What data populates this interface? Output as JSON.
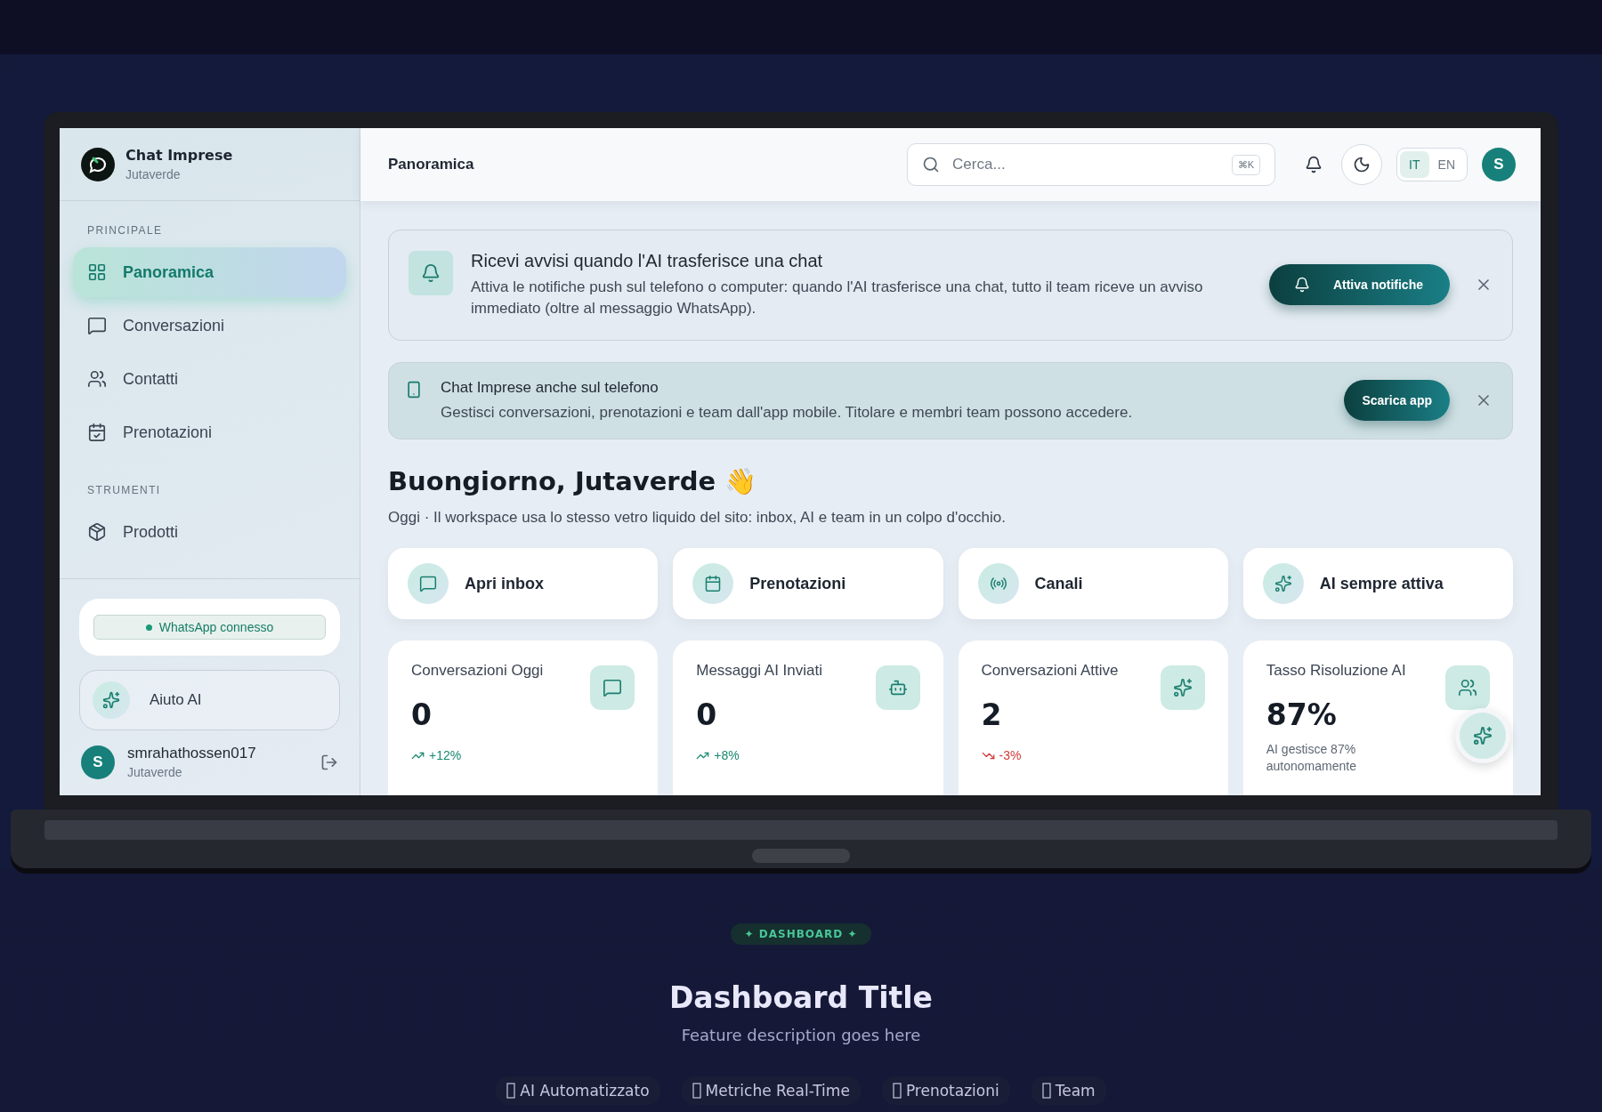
{
  "sidebar": {
    "brand": {
      "name": "Chat Imprese",
      "subtitle": "Jutaverde"
    },
    "sections": [
      {
        "title": "PRINCIPALE",
        "items": [
          {
            "label": "Panoramica",
            "selected": true
          },
          {
            "label": "Conversazioni",
            "selected": false
          },
          {
            "label": "Contatti",
            "selected": false
          },
          {
            "label": "Prenotazioni",
            "selected": false
          }
        ]
      },
      {
        "title": "STRUMENTI",
        "items": [
          {
            "label": "Prodotti",
            "selected": false
          }
        ]
      }
    ],
    "whatsapp_status": {
      "label": "WhatsApp connesso",
      "connected": true
    },
    "help": {
      "label": "Aiuto AI"
    },
    "user": {
      "initial": "S",
      "name": "smrahathossen017",
      "workspace": "Jutaverde"
    }
  },
  "topbar": {
    "title": "Panoramica",
    "search": {
      "placeholder": "Cerca...",
      "shortcut": "⌘K"
    },
    "languages": [
      {
        "label": "IT",
        "selected": true
      },
      {
        "label": "EN",
        "selected": false
      }
    ],
    "avatar": "S"
  },
  "banners": [
    {
      "kind": "alert",
      "title": "Ricevi avvisi quando l'AI trasferisce una chat",
      "text": "Attiva le notifiche push sul telefono o computer: quando l'AI trasferisce una chat, tutto il team riceve un avviso immediato (oltre al messaggio WhatsApp).",
      "button": "Attiva notifiche"
    },
    {
      "kind": "app",
      "title": "Chat Imprese anche sul telefono",
      "text": "Gestisci conversazioni, prenotazioni e team dall'app mobile. Titolare e membri team possono accedere.",
      "button": "Scarica app"
    }
  ],
  "greeting": {
    "title": "Buongiorno, Jutaverde 👋",
    "subtitle": "Oggi · Il workspace usa lo stesso vetro liquido del sito: inbox, AI e team in un colpo d'occhio."
  },
  "quick_actions": [
    {
      "label": "Apri inbox"
    },
    {
      "label": "Prenotazioni"
    },
    {
      "label": "Canali"
    },
    {
      "label": "AI sempre attiva"
    }
  ],
  "stats": [
    {
      "label": "Conversazioni Oggi",
      "value": "0",
      "trend": "+12%",
      "kind": "rising"
    },
    {
      "label": "Messaggi AI Inviati",
      "value": "0",
      "trend": "+8%",
      "kind": "rising"
    },
    {
      "label": "Conversazioni Attive",
      "value": "2",
      "trend": "-3%",
      "kind": "falling"
    },
    {
      "label": "Tasso Risoluzione AI",
      "value": "87%",
      "note": "AI gestisce 87% autonomamente"
    }
  ],
  "showcase": {
    "badge": "✦ DASHBOARD ✦",
    "title": "Dashboard Title",
    "subtitle": "Feature description goes here",
    "chips": [
      "AI Automatizzato",
      "Metriche Real-Time",
      "Prenotazioni",
      "Team"
    ]
  }
}
